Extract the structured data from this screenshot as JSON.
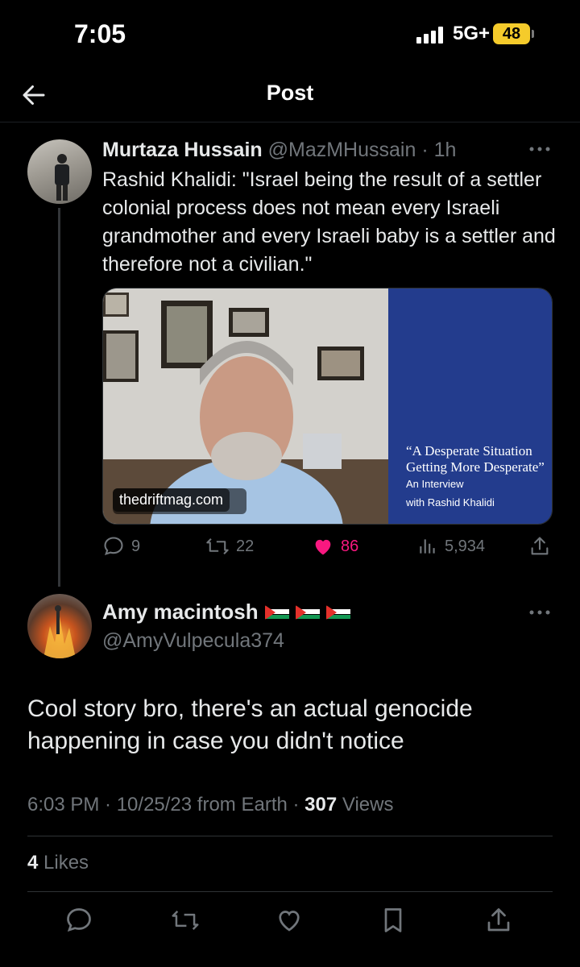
{
  "status_bar": {
    "time": "7:05",
    "network": "5G+",
    "battery": "48"
  },
  "header": {
    "title": "Post"
  },
  "parent_tweet": {
    "author_name": "Murtaza Hussain",
    "handle": "@MazMHussain",
    "separator": "·",
    "time": "1h",
    "text": "Rashid Khalidi: \"Israel being the result of a settler colonial process does not mean every Israeli grandmother and every Israeli baby is a settler and therefore not a civilian.\"",
    "media": {
      "source": "thedriftmag.com",
      "panel_title": "“A Desperate Situation Getting More Desperate”",
      "panel_sub": "An Interview",
      "panel_sub2": "with Rashid Khalidi"
    },
    "actions": {
      "replies": "9",
      "reposts": "22",
      "likes": "86",
      "views": "5,934"
    }
  },
  "reply_tweet": {
    "author_name": "Amy macintosh",
    "handle": "@AmyVulpecula374",
    "text": "Cool story bro, there's an actual genocide happening in case you didn't notice",
    "meta_time": "6:03 PM · 10/25/23 from Earth · ",
    "views_count": "307",
    "views_label": " Views",
    "likes_count": "4",
    "likes_label": " Likes"
  },
  "colors": {
    "background": "#000000",
    "text": "#e7e9ea",
    "muted": "#71767b",
    "like_active": "#f91880",
    "panel_blue": "#233c8d"
  }
}
